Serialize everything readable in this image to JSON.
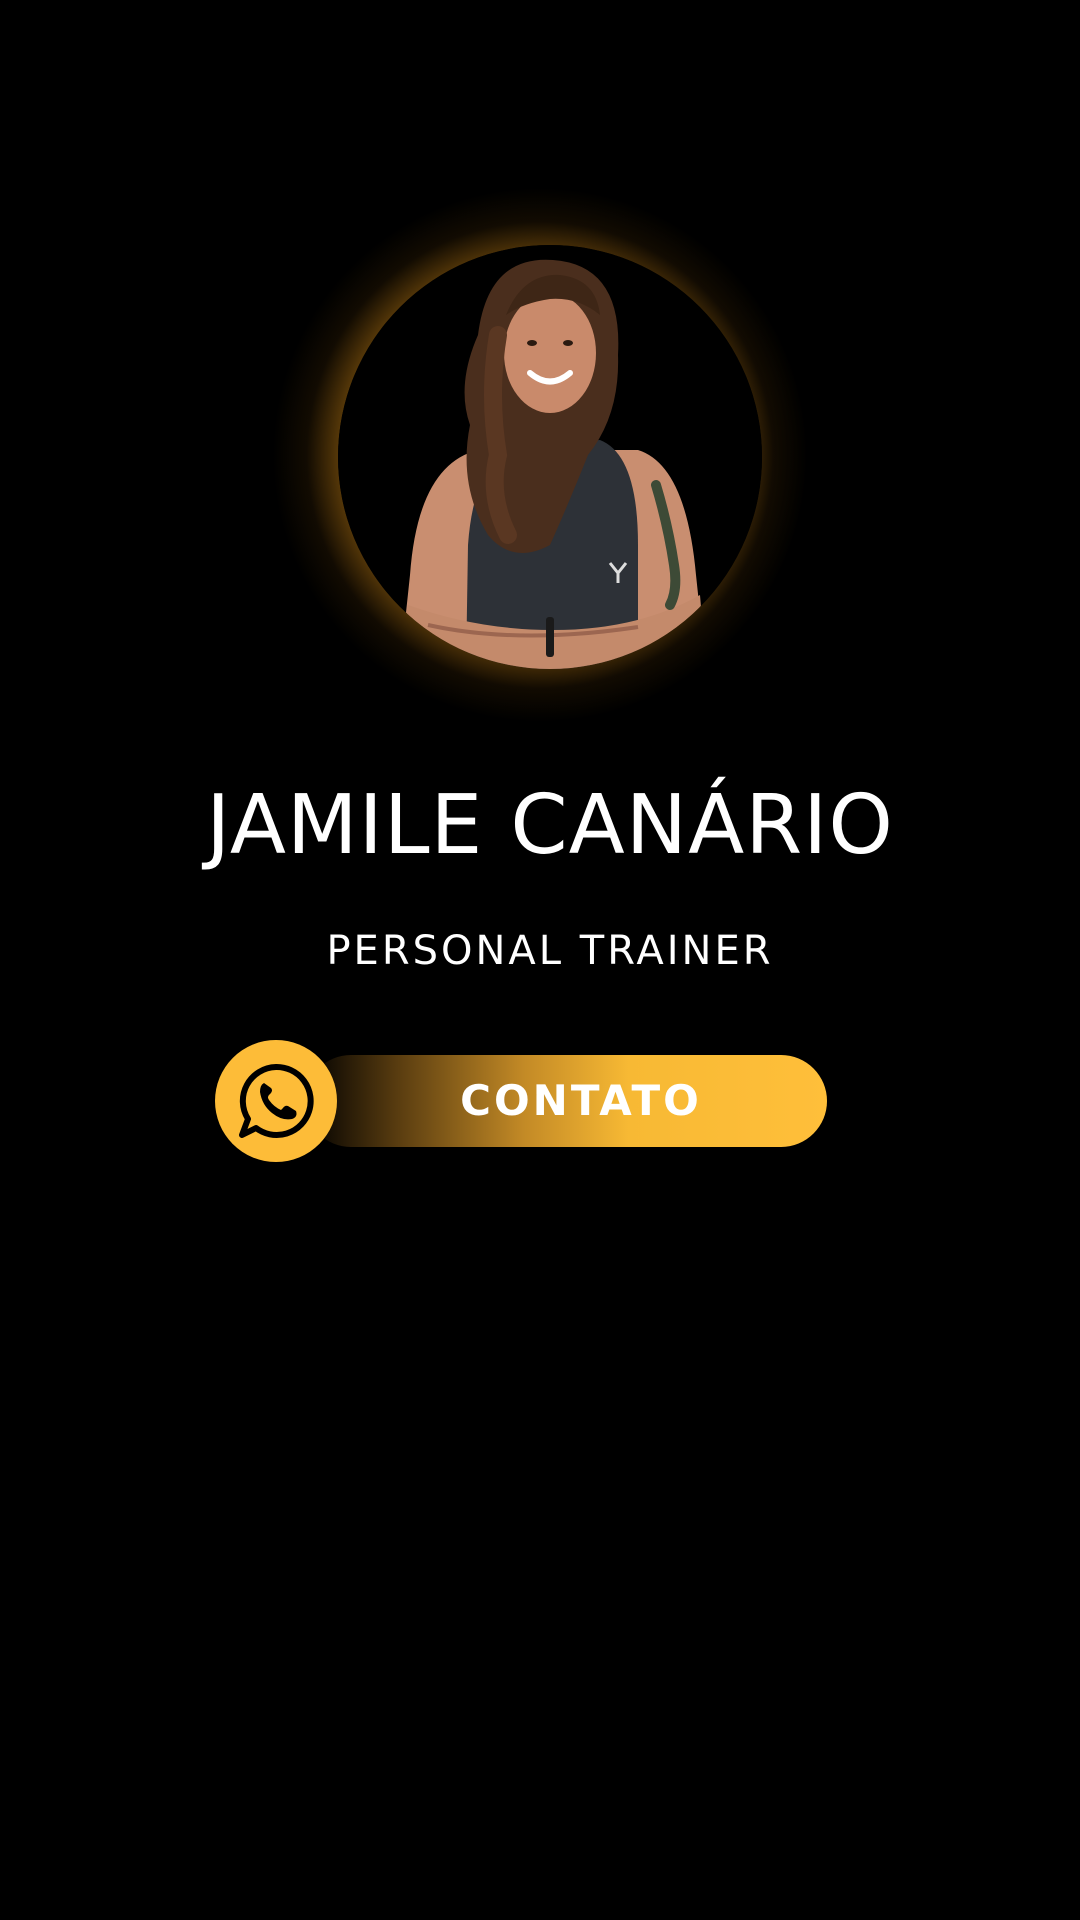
{
  "profile": {
    "name": "JAMILE CANÁRIO",
    "role": "PERSONAL TRAINER",
    "photo_icon": "profile-photo",
    "glow_color": "#ffbe3c"
  },
  "contact_button": {
    "label": "CONTATO",
    "icon": "whatsapp-icon",
    "accent_color": "#fdbc38"
  }
}
